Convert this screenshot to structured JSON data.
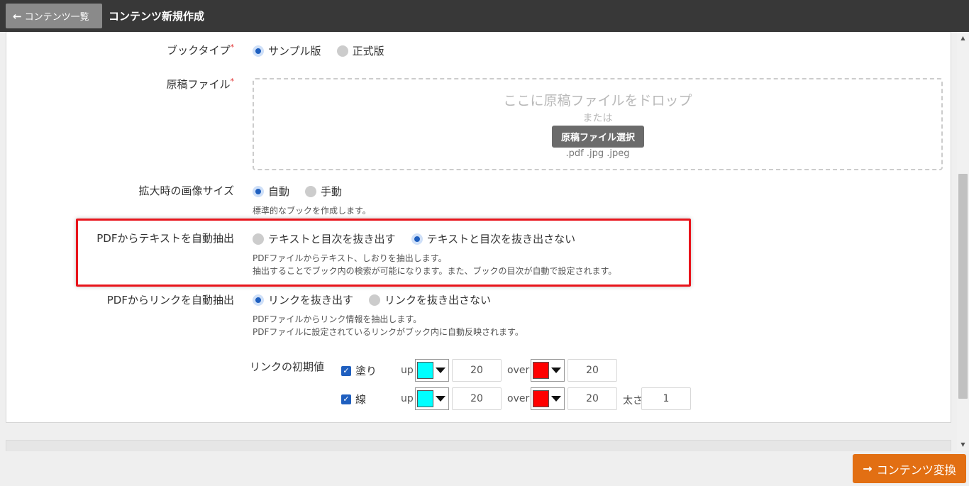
{
  "header": {
    "back_label": "コンテンツ一覧",
    "title": "コンテンツ新規作成"
  },
  "form": {
    "book_type": {
      "label": "ブックタイプ",
      "required_mark": "*",
      "options": [
        "サンプル版",
        "正式版"
      ],
      "selected": "サンプル版"
    },
    "manuscript": {
      "label": "原稿ファイル",
      "required_mark": "*",
      "drop_text": "ここに原稿ファイルをドロップ",
      "or_text": "または",
      "select_button": "原稿ファイル選択",
      "extensions": ".pdf .jpg .jpeg"
    },
    "zoom_size": {
      "label": "拡大時の画像サイズ",
      "options": [
        "自動",
        "手動"
      ],
      "selected": "自動",
      "help": "標準的なブックを作成します。"
    },
    "text_extract": {
      "label": "PDFからテキストを自動抽出",
      "options": [
        "テキストと目次を抜き出す",
        "テキストと目次を抜き出さない"
      ],
      "selected": "テキストと目次を抜き出さない",
      "help_line1": "PDFファイルからテキスト、しおりを抽出します。",
      "help_line2": "抽出することでブック内の検索が可能になります。また、ブックの目次が自動で設定されます。"
    },
    "link_extract": {
      "label": "PDFからリンクを自動抽出",
      "options": [
        "リンクを抜き出す",
        "リンクを抜き出さない"
      ],
      "selected": "リンクを抜き出す",
      "help_line1": "PDFファイルからリンク情報を抽出します。",
      "help_line2": "PDFファイルに設定されているリンクがブック内に自動反映されます。"
    },
    "link_defaults": {
      "label": "リンクの初期値",
      "fill": {
        "label": "塗り",
        "checked": true,
        "up_label": "up",
        "up_color": "#00ffff",
        "up_value": "20",
        "over_label": "over",
        "over_color": "#ff0000",
        "over_value": "20"
      },
      "line": {
        "label": "線",
        "checked": true,
        "up_label": "up",
        "up_color": "#00ffff",
        "up_value": "20",
        "over_label": "over",
        "over_color": "#ff0000",
        "over_value": "20",
        "width_label": "太さ",
        "width_value": "1"
      }
    }
  },
  "footer": {
    "convert_label": "コンテンツ変換"
  },
  "colors": {
    "accent_radio": "#1f5fbf",
    "convert_button": "#e26f13",
    "highlight_border": "#e8141b",
    "header_bg": "#383838"
  }
}
